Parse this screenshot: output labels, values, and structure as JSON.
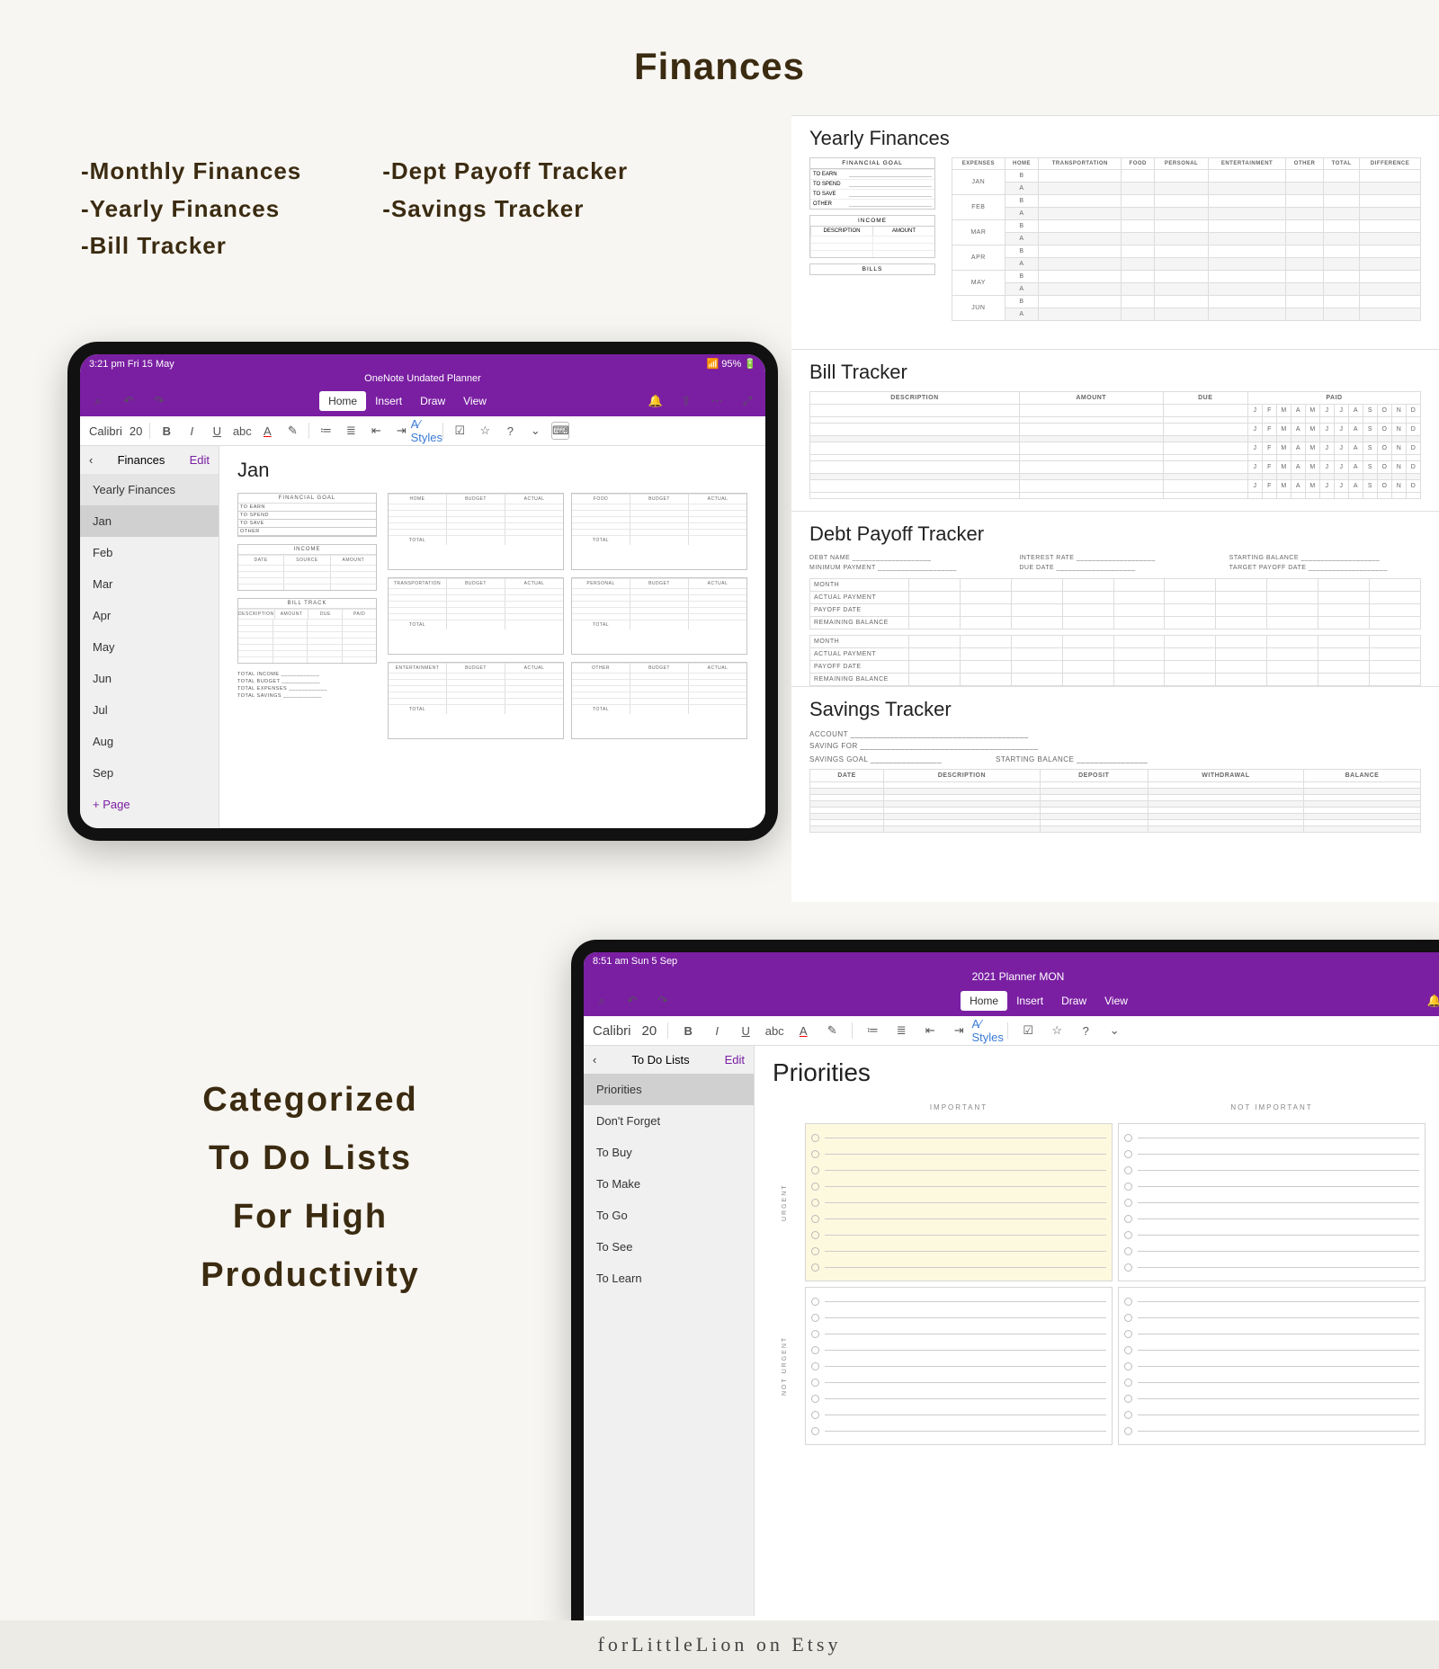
{
  "hero_title": "Finances",
  "bullets_left": [
    "-Monthly Finances",
    "-Yearly Finances",
    "-Bill Tracker"
  ],
  "bullets_right": [
    "-Dept Payoff Tracker",
    "-Savings Tracker"
  ],
  "tablet1": {
    "status_time": "3:21 pm  Fri 15 May",
    "status_battery": "95%",
    "app_title": "OneNote Undated Planner",
    "tabs": [
      "Home",
      "Insert",
      "Draw",
      "View"
    ],
    "active_tab": "Home",
    "font": "Calibri",
    "font_size": "20",
    "sidebar_title": "Finances",
    "edit": "Edit",
    "section": "Yearly Finances",
    "pages": [
      "Jan",
      "Feb",
      "Mar",
      "Apr",
      "May",
      "Jun",
      "Jul",
      "Aug",
      "Sep"
    ],
    "active_page": "Jan",
    "add_page": "+  Page",
    "page_heading": "Jan",
    "financial_goal_title": "FINANCIAL GOAL",
    "fg_rows": [
      "TO EARN",
      "TO SPEND",
      "TO SAVE",
      "OTHER"
    ],
    "income_title": "INCOME",
    "income_cols": [
      "DATE",
      "SOURCE",
      "AMOUNT"
    ],
    "bill_title": "BILL TRACK",
    "bill_cols": [
      "DESCRIPTION",
      "AMOUNT",
      "DUE",
      "PAID"
    ],
    "totals": [
      "TOTAL INCOME",
      "TOTAL BUDGET",
      "TOTAL EXPENSES",
      "TOTAL SAVINGS"
    ],
    "categories": [
      "HOME",
      "FOOD",
      "TRANSPORTATION",
      "PERSONAL",
      "ENTERTAINMENT",
      "OTHER"
    ],
    "bud_cols": [
      "BUDGET",
      "ACTUAL"
    ],
    "total": "TOTAL"
  },
  "yearly": {
    "title": "Yearly Finances",
    "goal_title": "FINANCIAL GOAL",
    "goal_rows": [
      "TO EARN",
      "TO SPEND",
      "TO SAVE",
      "OTHER"
    ],
    "income_title": "INCOME",
    "income_cols": [
      "DESCRIPTION",
      "AMOUNT"
    ],
    "bills_title": "BILLS",
    "months": [
      "JAN",
      "FEB",
      "MAR",
      "APR",
      "MAY",
      "JUN"
    ],
    "exp_cols": [
      "EXPENSES",
      "HOME",
      "TRANSPORTATION",
      "FOOD",
      "PERSONAL",
      "ENTERTAINMENT",
      "OTHER",
      "TOTAL",
      "DIFFERENCE"
    ],
    "sub": [
      "B",
      "A"
    ]
  },
  "bill_tracker": {
    "title": "Bill Tracker",
    "cols": [
      "DESCRIPTION",
      "AMOUNT",
      "DUE",
      "PAID"
    ],
    "months": [
      "J",
      "F",
      "M",
      "A",
      "M",
      "J",
      "J",
      "A",
      "S",
      "O",
      "N",
      "D"
    ]
  },
  "debt": {
    "title": "Debt Payoff Tracker",
    "fields_l": [
      "DEBT NAME",
      "MINIMUM PAYMENT"
    ],
    "fields_m": [
      "INTEREST RATE",
      "DUE DATE"
    ],
    "fields_r": [
      "STARTING BALANCE",
      "TARGET PAYOFF DATE"
    ],
    "block_rows": [
      "MONTH",
      "ACTUAL PAYMENT",
      "PAYOFF DATE",
      "REMAINING BALANCE"
    ]
  },
  "savings": {
    "title": "Savings Tracker",
    "lines": [
      "ACCOUNT",
      "SAVING FOR"
    ],
    "goal": "SAVINGS GOAL",
    "start": "STARTING BALANCE",
    "cols": [
      "DATE",
      "DESCRIPTION",
      "DEPOSIT",
      "WITHDRAWAL",
      "BALANCE"
    ]
  },
  "mega": [
    "Categorized",
    "To Do Lists",
    "For High",
    "Productivity"
  ],
  "tablet2": {
    "status_time": "8:51 am  Sun 5 Sep",
    "app_title": "2021 Planner MON",
    "tabs": [
      "Home",
      "Insert",
      "Draw",
      "View"
    ],
    "active_tab": "Home",
    "font": "Calibri",
    "font_size": "20",
    "sidebar_title": "To Do Lists",
    "edit": "Edit",
    "pages": [
      "Priorities",
      "Don't Forget",
      "To Buy",
      "To Make",
      "To Go",
      "To See",
      "To Learn"
    ],
    "active_page": "Priorities",
    "page_heading": "Priorities",
    "col_important": "IMPORTANT",
    "col_not": "NOT IMPORTANT",
    "row_urgent": "URGENT",
    "row_not": "NOT URGENT"
  },
  "footer": "forLittleLion on Etsy"
}
